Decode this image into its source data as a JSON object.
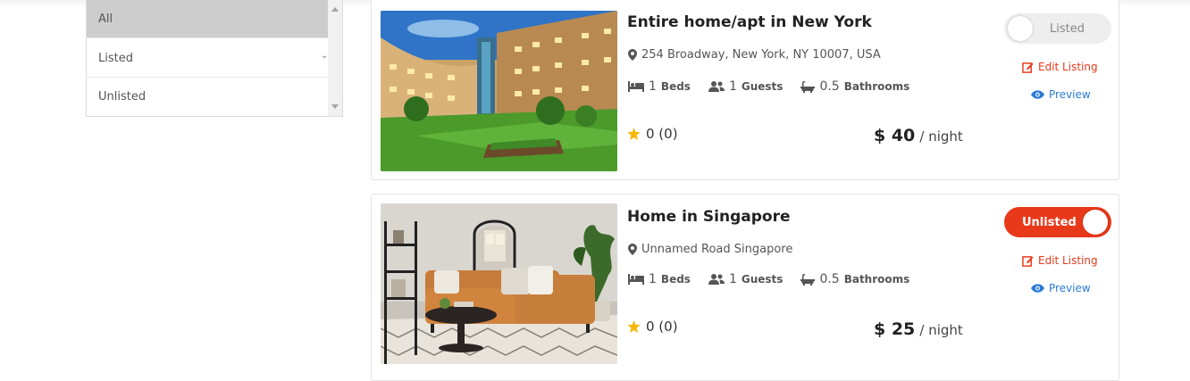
{
  "filter": {
    "options": [
      "All",
      "Listed",
      "Unlisted"
    ],
    "selected": "All"
  },
  "listings": [
    {
      "title": "Entire home/apt in New York",
      "address": "254 Broadway, New York, NY 10007, USA",
      "beds_count": "1",
      "beds_label": "Beds",
      "guests_count": "1",
      "guests_label": "Guests",
      "bathrooms_count": "0.5",
      "bathrooms_label": "Bathrooms",
      "rating": "0 (0)",
      "price": "$ 40",
      "price_unit": "/ night",
      "status": "Listed",
      "status_on": false,
      "edit_label": "Edit Listing",
      "preview_label": "Preview",
      "image": "hotel courtyard with lawn and pool"
    },
    {
      "title": "Home in Singapore",
      "address": "Unnamed Road Singapore",
      "beds_count": "1",
      "beds_label": "Beds",
      "guests_count": "1",
      "guests_label": "Guests",
      "bathrooms_count": "0.5",
      "bathrooms_label": "Bathrooms",
      "rating": "0 (0)",
      "price": "$ 25",
      "price_unit": "/ night",
      "status": "Unlisted",
      "status_on": true,
      "edit_label": "Edit Listing",
      "preview_label": "Preview",
      "image": "living room with orange sofa"
    }
  ],
  "colors": {
    "accent_red": "#e8391a",
    "link_blue": "#2b7bd6",
    "star": "#f5b800"
  }
}
